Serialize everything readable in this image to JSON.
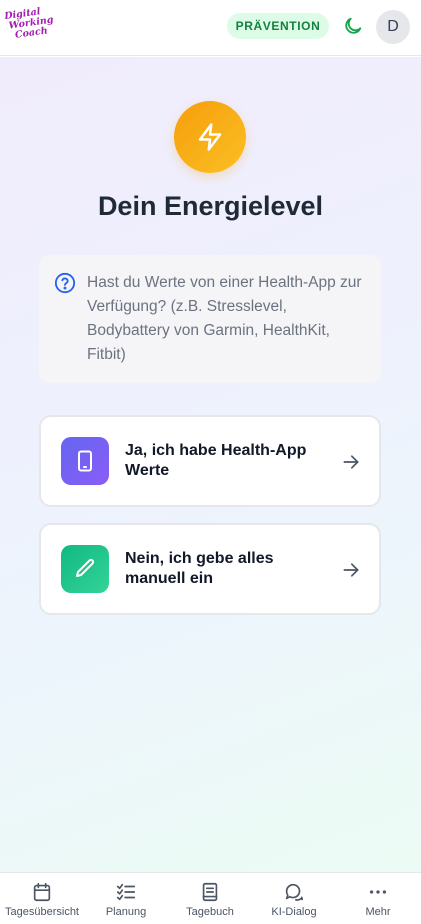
{
  "header": {
    "logo": [
      "Digital",
      "Working",
      "Coach"
    ],
    "badge": "PRÄVENTION",
    "avatar_initial": "D",
    "moon_icon": "moon-icon"
  },
  "page": {
    "title": "Dein Energielevel",
    "info_text": "Hast du Werte von einer Health-App zur Verfügung? (z.B. Stresslevel, Bodybattery von Garmin, HealthKit, Fitbit)"
  },
  "options": [
    {
      "label": "Ja, ich habe Health-App Werte",
      "icon": "smartphone-icon",
      "color": "#7c6cf4"
    },
    {
      "label": "Nein, ich gebe alles manuell ein",
      "icon": "pencil-icon",
      "color": "#1fbf85"
    }
  ],
  "colors": {
    "accent_amber": "#f5a30b",
    "badge_bg": "#dcfce7",
    "badge_text": "#15803d",
    "moon": "#16a34a"
  },
  "nav": [
    {
      "label": "Tagesübersicht",
      "icon": "calendar-icon"
    },
    {
      "label": "Planung",
      "icon": "checklist-icon"
    },
    {
      "label": "Tagebuch",
      "icon": "book-icon"
    },
    {
      "label": "KI-Dialog",
      "icon": "chat-icon"
    },
    {
      "label": "Mehr",
      "icon": "more-icon"
    }
  ]
}
